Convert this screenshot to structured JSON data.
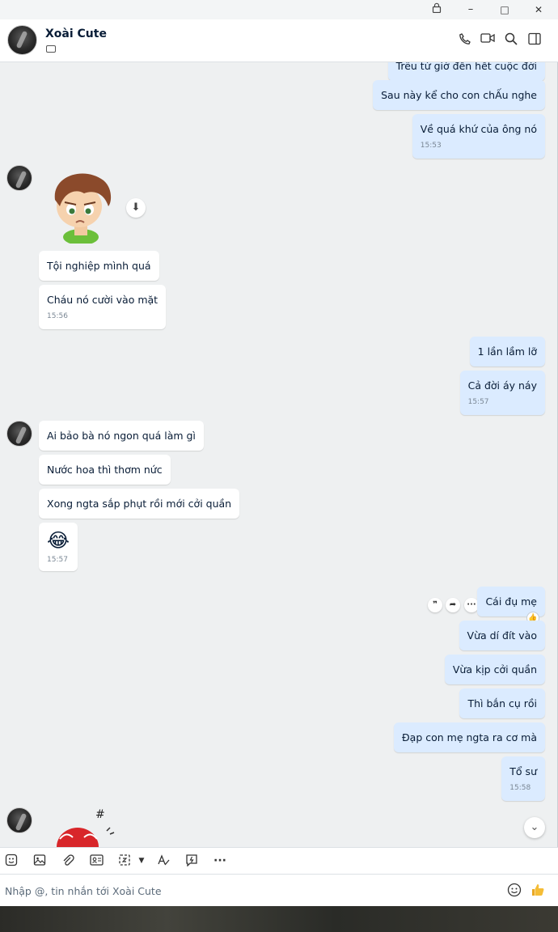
{
  "window": {
    "lock_icon": "lock-icon",
    "minimize": "–",
    "maximize": "□",
    "close": "✕"
  },
  "header": {
    "contact_name": "Xoài Cute",
    "icons": [
      "phone-icon",
      "video-icon",
      "search-icon",
      "sidebar-toggle-icon"
    ]
  },
  "messages": [
    {
      "side": "me",
      "text": "Trêu từ giờ đến hết cuộc đời",
      "time": ""
    },
    {
      "side": "me",
      "text": "Sau này kể cho con chẤu nghe",
      "time": ""
    },
    {
      "side": "me",
      "text": "Về quá khứ của ông nó",
      "time": "15:53"
    },
    {
      "side": "them",
      "text": "Tội nghiệp mình quá",
      "time": ""
    },
    {
      "side": "them",
      "text": "Cháu nó cười vào mặt",
      "time": "15:56"
    },
    {
      "side": "me",
      "text": "1 lần lầm lỡ",
      "time": ""
    },
    {
      "side": "me",
      "text": "Cả đời áy náy",
      "time": "15:57"
    },
    {
      "side": "them",
      "text": "Ai bảo bà nó ngon quá làm gì",
      "time": ""
    },
    {
      "side": "them",
      "text": "Nước hoa thì thơm nức",
      "time": ""
    },
    {
      "side": "them",
      "text": "Xong ngta sắp phụt rồi mới cởi quần",
      "time": ""
    },
    {
      "side": "them",
      "text": "😂",
      "time": "15:57"
    },
    {
      "side": "me",
      "text": "Cái đụ mẹ",
      "time": ""
    },
    {
      "side": "me",
      "text": "Vừa dí đít vào",
      "time": ""
    },
    {
      "side": "me",
      "text": "Vừa kịp cởi quần",
      "time": ""
    },
    {
      "side": "me",
      "text": "Thì bắn cụ rồi",
      "time": ""
    },
    {
      "side": "me",
      "text": "Đạp con mẹ ngta ra cơ mà",
      "time": ""
    },
    {
      "side": "me",
      "text": "Tổ sư",
      "time": "15:58"
    }
  ],
  "message_actions": {
    "quote": "❞",
    "forward": "➦",
    "more": "···"
  },
  "composer": {
    "placeholder": "Nhập @, tin nhắn tới Xoài Cute",
    "value": "",
    "tools": [
      "sticker-icon",
      "image-icon",
      "attachment-icon",
      "contact-card-icon",
      "screenshot-icon",
      "text-format-icon",
      "quick-message-icon",
      "more-icon"
    ]
  }
}
